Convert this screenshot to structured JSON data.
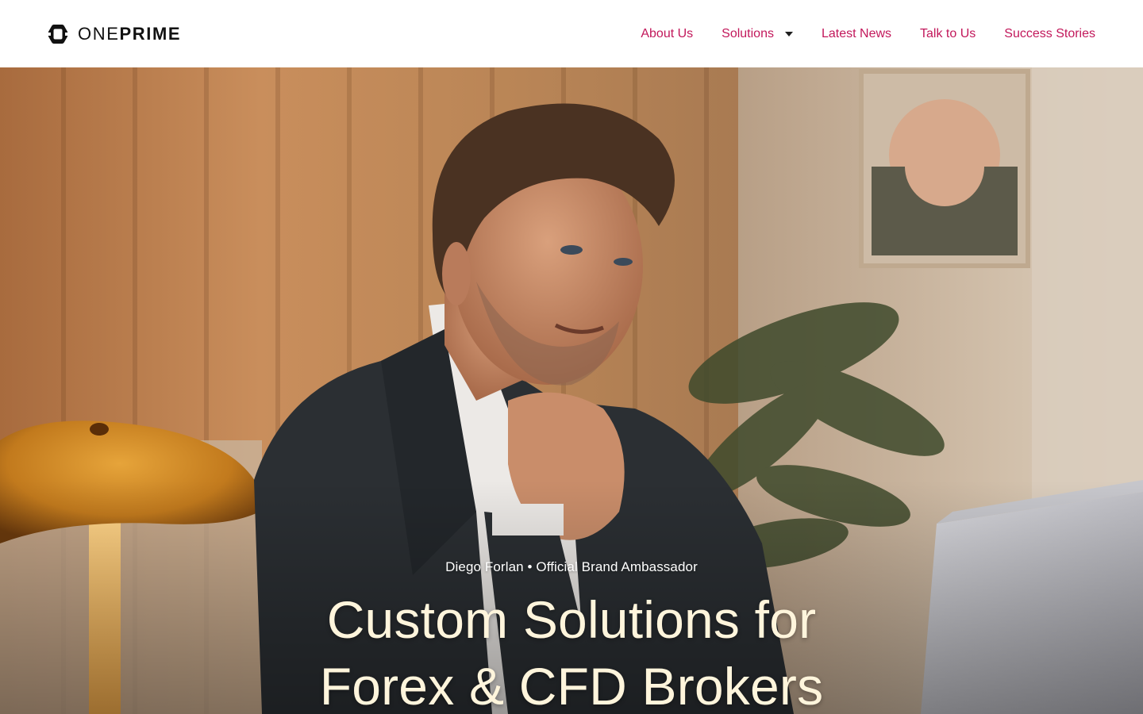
{
  "header": {
    "logo": {
      "light": "ONE",
      "bold": "PRIME"
    },
    "nav": [
      {
        "label": "About Us"
      },
      {
        "label": "Solutions",
        "has_dropdown": true
      },
      {
        "label": "Latest News"
      },
      {
        "label": "Talk to Us"
      },
      {
        "label": "Success Stories"
      }
    ]
  },
  "hero": {
    "tagline": "Diego Forlan • Official Brand Ambassador",
    "headline_line1": "Custom Solutions for",
    "headline_line2": "Forex & CFD Brokers"
  },
  "colors": {
    "nav_link": "#c2185b",
    "logo": "#111111",
    "headline": "#fff5dc"
  },
  "icons": {
    "logo_mark": "oneprime-logo-icon",
    "dropdown": "caret-down-icon"
  }
}
